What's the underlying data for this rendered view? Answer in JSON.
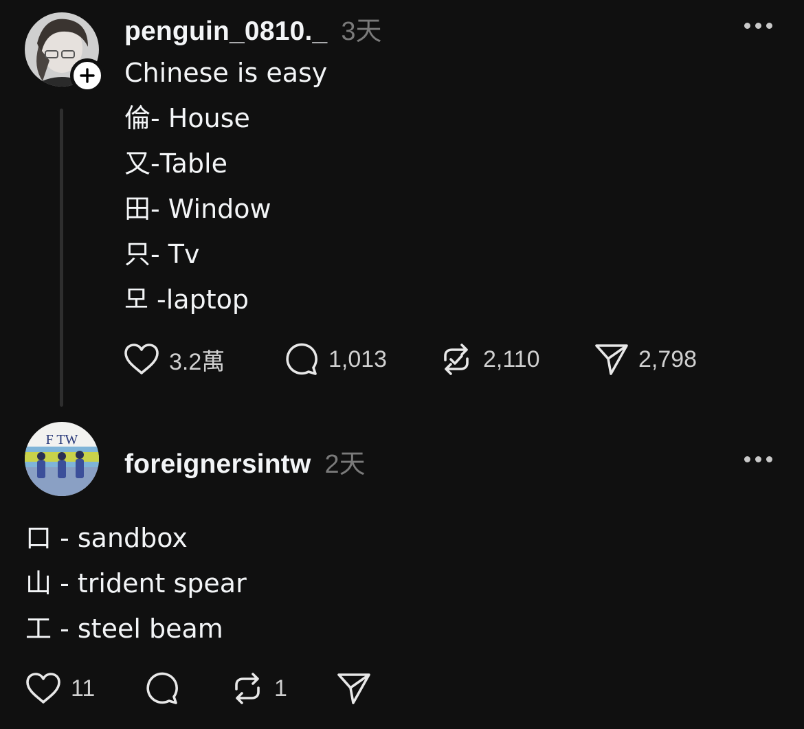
{
  "posts": [
    {
      "username": "penguin_0810._",
      "time": "3天",
      "lines": [
        "Chinese is easy",
        "倫- House",
        "又-Table",
        "田- Window",
        "只- Tv",
        "모 -laptop"
      ],
      "actions": {
        "likes": "3.2萬",
        "replies": "1,013",
        "reposts": "2,110",
        "shares": "2,798"
      },
      "icons": [
        "heart-icon",
        "comment-icon",
        "repost-icon",
        "share-icon",
        "more-icon",
        "plus-icon"
      ]
    },
    {
      "username": "foreignersintw",
      "time": "2天",
      "avatar_text": "F TW",
      "lines": [
        "口 - sandbox",
        "山 - trident spear",
        "工 - steel beam"
      ],
      "actions": {
        "likes": "11",
        "replies": "",
        "reposts": "1",
        "shares": ""
      },
      "icons": [
        "heart-icon",
        "comment-icon",
        "repost-icon",
        "share-icon",
        "more-icon"
      ]
    }
  ],
  "colors": {
    "background": "#101010",
    "text": "#f3f5f7",
    "muted": "#7a7a7a",
    "thread_line": "#2e2e2e"
  }
}
